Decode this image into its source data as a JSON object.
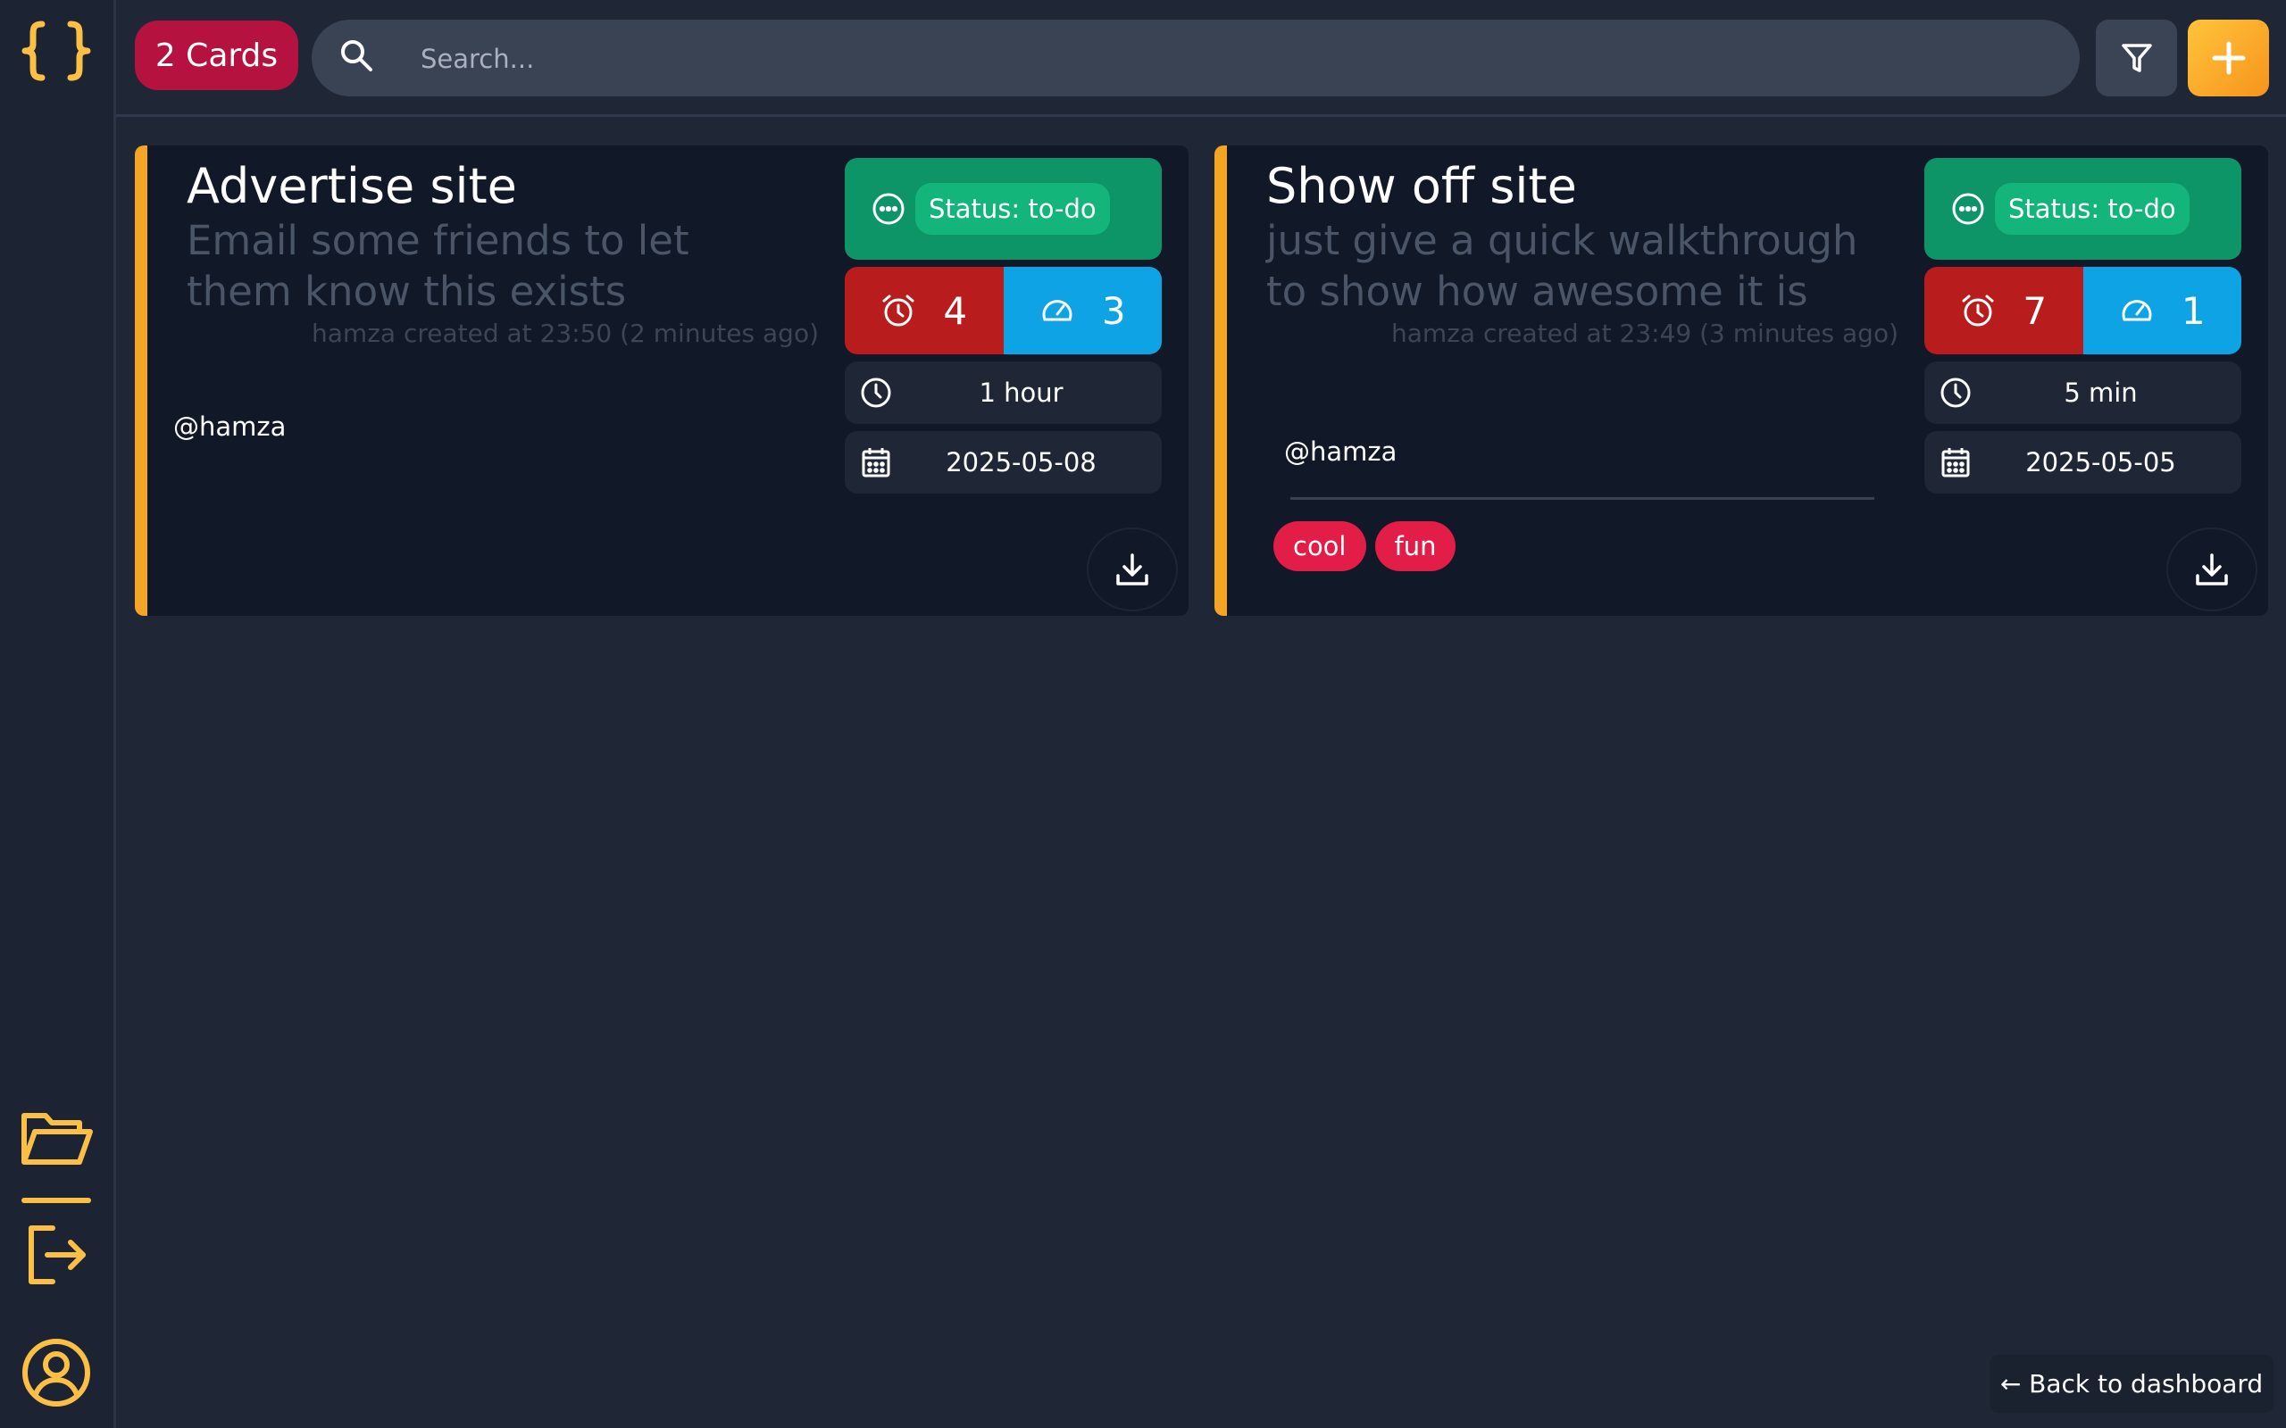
{
  "topbar": {
    "cards_count_label": "2 Cards",
    "search_placeholder": "Search..."
  },
  "cards": [
    {
      "title": "Advertise site",
      "description": "Email some friends to let them know this exists",
      "meta": "hamza created at 23:50 (2 minutes ago)",
      "assignee": "@hamza",
      "status": "Status: to-do",
      "priority": "4",
      "effort": "3",
      "duration": "1 hour",
      "date": "2025-05-08",
      "tags": []
    },
    {
      "title": "Show off site",
      "description": "just give a quick walkthrough to show how awesome it is",
      "meta": "hamza created at 23:49 (3 minutes ago)",
      "assignee": "@hamza",
      "status": "Status: to-do",
      "priority": "7",
      "effort": "1",
      "duration": "5 min",
      "date": "2025-05-05",
      "tags": [
        "cool",
        "fun"
      ]
    }
  ],
  "footer": {
    "back_label": "← Back to dashboard"
  },
  "icons": {
    "logo": "curly-braces-icon",
    "folder": "folder-open-icon",
    "logout": "logout-icon",
    "profile": "user-circle-icon",
    "search": "search-icon",
    "filter": "filter-icon",
    "add": "plus-icon",
    "status": "dots-circle-icon",
    "priority": "alarm-clock-icon",
    "effort": "speedometer-icon",
    "duration": "clock-icon",
    "date": "calendar-icon",
    "download": "download-icon"
  },
  "colors": {
    "background": "#1f2737",
    "card": "#111827",
    "accent": "#f5a524",
    "count_badge": "#b6123f",
    "status": "#0d9568",
    "priority": "#b81c1c",
    "effort": "#0ea3e5",
    "tag": "#e11d48",
    "sidebar_icon": "#fbbf45"
  }
}
